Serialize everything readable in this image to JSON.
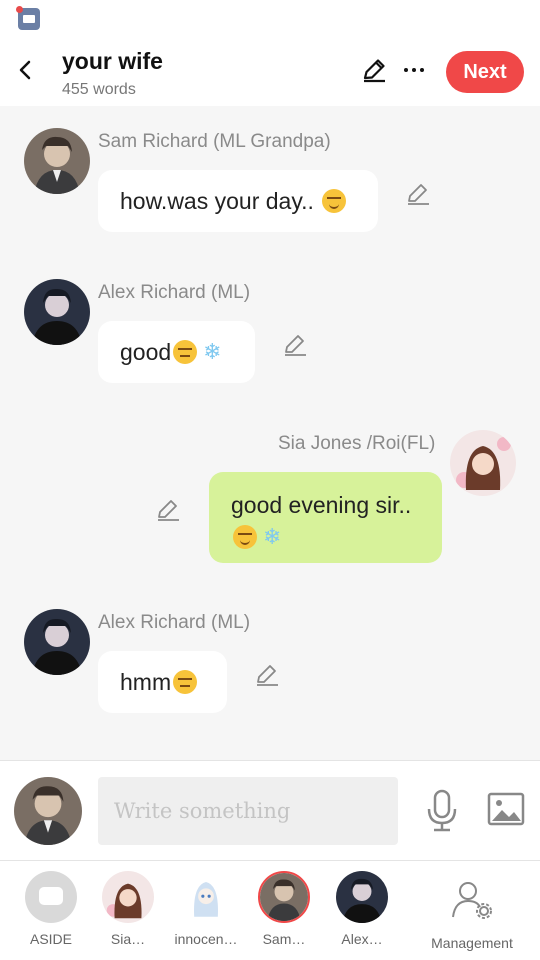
{
  "header": {
    "title": "your wife",
    "word_count": "455 words",
    "next_label": "Next"
  },
  "messages": [
    {
      "name": "Sam Richard  (ML Grandpa)",
      "text": "how.was your day..",
      "emoji": "smile"
    },
    {
      "name": "Alex Richard  (ML)",
      "text": "good",
      "emoji": "meh",
      "extra": "snowflake"
    },
    {
      "name": "Sia Jones /Roi(FL)",
      "text": "good evening sir..",
      "emoji": "smile",
      "extra": "snowflake"
    },
    {
      "name": "Alex Richard  (ML)",
      "text": "hmm",
      "emoji": "meh"
    }
  ],
  "input": {
    "placeholder": "Write something"
  },
  "tabs": [
    "ASIDE",
    "Sia…",
    "innocen…",
    "Sam…",
    "Alex…",
    "Management"
  ],
  "colors": {
    "accent": "#f04848",
    "my_bubble": "#d7f29a",
    "background": "#f6f6f6"
  }
}
